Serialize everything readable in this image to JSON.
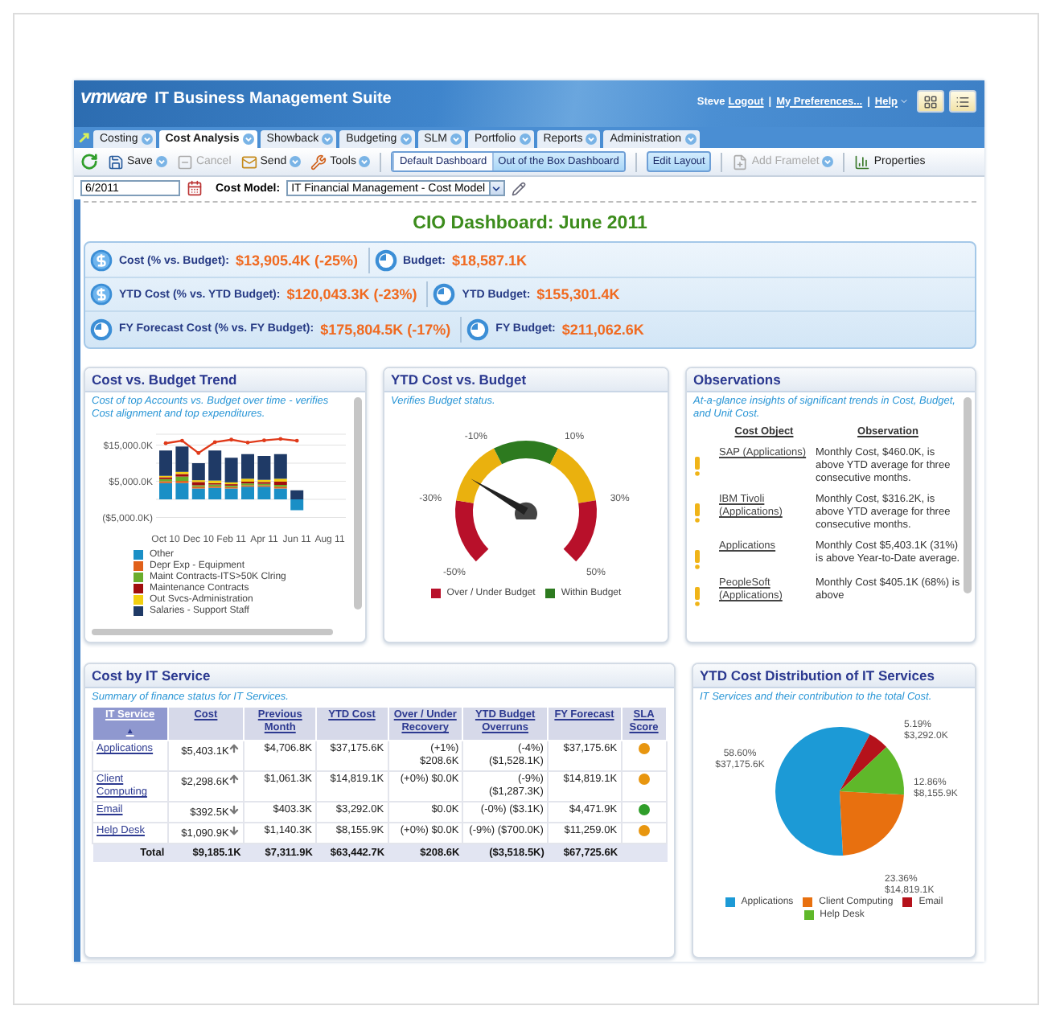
{
  "header": {
    "logo": "vmware",
    "title": "IT Business Management Suite",
    "user": "Steve",
    "separator": "|",
    "links": [
      {
        "label": "Logout",
        "menu": false
      },
      {
        "label": "My Preferences...",
        "menu": false
      },
      {
        "label": "Help",
        "menu": true
      }
    ]
  },
  "tabs": [
    {
      "label": "Costing",
      "selected": false
    },
    {
      "label": "Cost Analysis",
      "selected": true
    },
    {
      "label": "Showback",
      "selected": false
    },
    {
      "label": "Budgeting",
      "selected": false
    },
    {
      "label": "SLM",
      "selected": false
    },
    {
      "label": "Portfolio",
      "selected": false
    },
    {
      "label": "Reports",
      "selected": false
    },
    {
      "label": "Administration",
      "selected": false
    }
  ],
  "toolbar": {
    "buttons": [
      {
        "label": "Save",
        "menu": true,
        "disabled": false
      },
      {
        "label": "Cancel",
        "menu": false,
        "disabled": true
      },
      {
        "label": "Send",
        "menu": true,
        "disabled": false
      },
      {
        "label": "Tools",
        "menu": true,
        "disabled": false
      }
    ],
    "dashboards": [
      {
        "label": "Default Dashboard",
        "selected": false
      },
      {
        "label": "Out of the Box Dashboard",
        "selected": true
      }
    ],
    "edit_layout": {
      "label": "Edit Layout",
      "pressed": true
    },
    "tail_buttons": [
      {
        "label": "Add Framelet",
        "menu": true,
        "disabled": true
      },
      {
        "label": "Properties",
        "menu": false,
        "disabled": false
      }
    ]
  },
  "filter": {
    "period": "6/2011",
    "cost_model_label": "Cost Model:",
    "cost_model": "IT Financial Management - Cost Model"
  },
  "title": "CIO Dashboard: June 2011",
  "kpis": [
    {
      "items": [
        {
          "kind": "currency",
          "label": "Cost (% vs. Budget):",
          "value": "$13,905.4K (-25%)"
        },
        {
          "kind": "time",
          "label": "Budget:",
          "value": "$18,587.1K"
        }
      ]
    },
    {
      "items": [
        {
          "kind": "currency",
          "label": "YTD Cost (% vs. YTD Budget):",
          "value": "$120,043.3K (-23%)"
        },
        {
          "kind": "time",
          "label": "YTD Budget:",
          "value": "$155,301.4K"
        }
      ]
    },
    {
      "items": [
        {
          "kind": "time",
          "label": "FY Forecast Cost (% vs. FY Budget):",
          "value": "$175,804.5K (-17%)"
        },
        {
          "kind": "time",
          "label": "FY Budget:",
          "value": "$211,062.6K"
        }
      ]
    }
  ],
  "trend": {
    "title": "Cost vs. Budget Trend",
    "description": "Cost of top Accounts vs. Budget over time - verifies Cost alignment and top expenditures.",
    "chart_data": {
      "type": "bar",
      "stacked": true,
      "categories": [
        "Oct 10",
        null,
        "Dec 10",
        null,
        "Feb 11",
        null,
        "Apr 11",
        null,
        "Jun 11",
        null,
        "Aug 11"
      ],
      "ylim": [
        -6000,
        18000
      ],
      "yticks": [
        {
          "value": -5000,
          "label": "($5,000.0K)"
        },
        {
          "value": 5000,
          "label": "$5,000.0K"
        },
        {
          "value": 15000,
          "label": "$15,000.0K"
        }
      ],
      "series": [
        {
          "name": "Other",
          "color": "#1a8fc6",
          "values": [
            4500,
            4500,
            3000,
            3200,
            3000,
            3500,
            3500,
            3000,
            -3000,
            null,
            null
          ]
        },
        {
          "name": "Depr Exp - Equipment",
          "color": "#e0601a",
          "values": [
            500,
            600,
            500,
            400,
            400,
            400,
            400,
            500,
            0,
            null,
            null
          ]
        },
        {
          "name": "Maint Contracts-ITS>50K Clring",
          "color": "#6aad2c",
          "values": [
            600,
            1200,
            400,
            500,
            400,
            500,
            400,
            500,
            0,
            null,
            null
          ]
        },
        {
          "name": "Maintenance Contracts",
          "color": "#a10d0d",
          "values": [
            500,
            700,
            900,
            400,
            400,
            500,
            500,
            900,
            0,
            null,
            null
          ]
        },
        {
          "name": "Out Svcs-Administration",
          "color": "#f2cf10",
          "values": [
            400,
            600,
            500,
            700,
            500,
            800,
            600,
            800,
            0,
            null,
            null
          ]
        },
        {
          "name": "Salaries - Support Staff",
          "color": "#1f3a66",
          "values": [
            7000,
            7000,
            4700,
            8300,
            6800,
            6800,
            6600,
            6800,
            2500,
            null,
            null
          ]
        },
        {
          "type": "line",
          "color": "#e03a1a",
          "values": [
            15500,
            16200,
            12800,
            15800,
            16500,
            15700,
            16300,
            16700,
            16200,
            null,
            null
          ]
        }
      ]
    }
  },
  "gauge": {
    "title": "YTD Cost vs. Budget",
    "description": "Verifies Budget status.",
    "level": 0.28,
    "ticks": [
      {
        "label": "-50%"
      },
      {
        "label": "-30%"
      },
      {
        "label": "-10%"
      },
      {
        "label": "10%"
      },
      {
        "label": "30%"
      },
      {
        "label": "50%"
      }
    ],
    "legend": [
      {
        "label": "Over / Under Budget",
        "color": "#b8102a"
      },
      {
        "label": "Within Budget",
        "color": "#2d7a1f"
      }
    ]
  },
  "observations": {
    "title": "Observations",
    "description": "At-a-glance insights of significant trends in Cost, Budget, and Unit Cost.",
    "columns": [
      "Cost Object",
      "Observation"
    ],
    "rows": [
      {
        "object": "SAP (Applications)",
        "text": "Monthly Cost, $460.0K, is above YTD average for three consecutive months."
      },
      {
        "object": "IBM Tivoli (Applications)",
        "text": "Monthly Cost, $316.2K, is above YTD average for three consecutive months."
      },
      {
        "object": "Applications",
        "text": "Monthly Cost $5,403.1K (31%) is above Year-to-Date average."
      },
      {
        "object": "PeopleSoft (Applications)",
        "text": "Monthly Cost $405.1K (68%) is above"
      }
    ]
  },
  "services": {
    "title": "Cost by IT Service",
    "description": "Summary of finance status for IT Services.",
    "columns": [
      {
        "label": "IT Service",
        "sort_mark": "▲",
        "selected": true
      },
      {
        "label": "Cost",
        "selected": false
      },
      {
        "label": "Previous Month",
        "selected": false
      },
      {
        "label": "YTD Cost",
        "selected": false
      },
      {
        "label": "Over / Under Recovery",
        "selected": false
      },
      {
        "label": "YTD Budget Overruns",
        "selected": false
      },
      {
        "label": "FY Forecast",
        "selected": false
      },
      {
        "label": "SLA Score",
        "selected": false
      }
    ],
    "rows": [
      {
        "service": "Applications",
        "cost": "$5,403.1K",
        "increased": true,
        "previous_month": "$4,706.8K",
        "ytd_cost": "$37,175.6K",
        "recovery": "(+1%) $208.6K",
        "overruns": "(-4%) ($1,528.1K)",
        "forecast": "$37,175.6K",
        "color": "#e8960f"
      },
      {
        "service": "Client Computing",
        "cost": "$2,298.6K",
        "increased": true,
        "previous_month": "$1,061.3K",
        "ytd_cost": "$14,819.1K",
        "recovery": "(+0%) $0.0K",
        "overruns": "(-9%) ($1,287.3K)",
        "forecast": "$14,819.1K",
        "color": "#e8960f"
      },
      {
        "service": "Email",
        "cost": "$392.5K",
        "increased": false,
        "previous_month": "$403.3K",
        "ytd_cost": "$3,292.0K",
        "recovery": "$0.0K",
        "overruns": "(-0%) ($3.1K)",
        "forecast": "$4,471.9K",
        "color": "#2f9e2a"
      },
      {
        "service": "Help Desk",
        "cost": "$1,090.9K",
        "increased": false,
        "previous_month": "$1,140.3K",
        "ytd_cost": "$8,155.9K",
        "recovery": "(+0%) $0.0K",
        "overruns": "(-9%) ($700.0K)",
        "forecast": "$11,259.0K",
        "color": "#e8960f"
      }
    ],
    "total": {
      "label": "Total",
      "cost": "$9,185.1K",
      "previous_month": "$7,311.9K",
      "ytd_cost": "$63,442.7K",
      "recovery": "$208.6K",
      "overruns": "($3,518.5K)",
      "forecast": "$67,725.6K"
    }
  },
  "distribution": {
    "title": "YTD Cost Distribution of IT Services",
    "description": "IT Services and their contribution to the total Cost.",
    "chart_data": {
      "type": "pie",
      "categories": [
        "Applications",
        "Client Computing",
        "Email",
        "Help Desk"
      ],
      "colors": [
        "#1c9ad6",
        "#e8700f",
        "#b5121b",
        "#5fb82a"
      ],
      "series": [
        {
          "values": [
            58.6,
            23.36,
            5.19,
            12.86
          ]
        }
      ],
      "value_labels": [
        {
          "percent": "58.60%",
          "amount": "$37,175.6K"
        },
        {
          "percent": "23.36%",
          "amount": "$14,819.1K"
        },
        {
          "percent": "5.19%",
          "amount": "$3,292.0K"
        },
        {
          "percent": "12.86%",
          "amount": "$8,155.9K"
        }
      ]
    }
  }
}
